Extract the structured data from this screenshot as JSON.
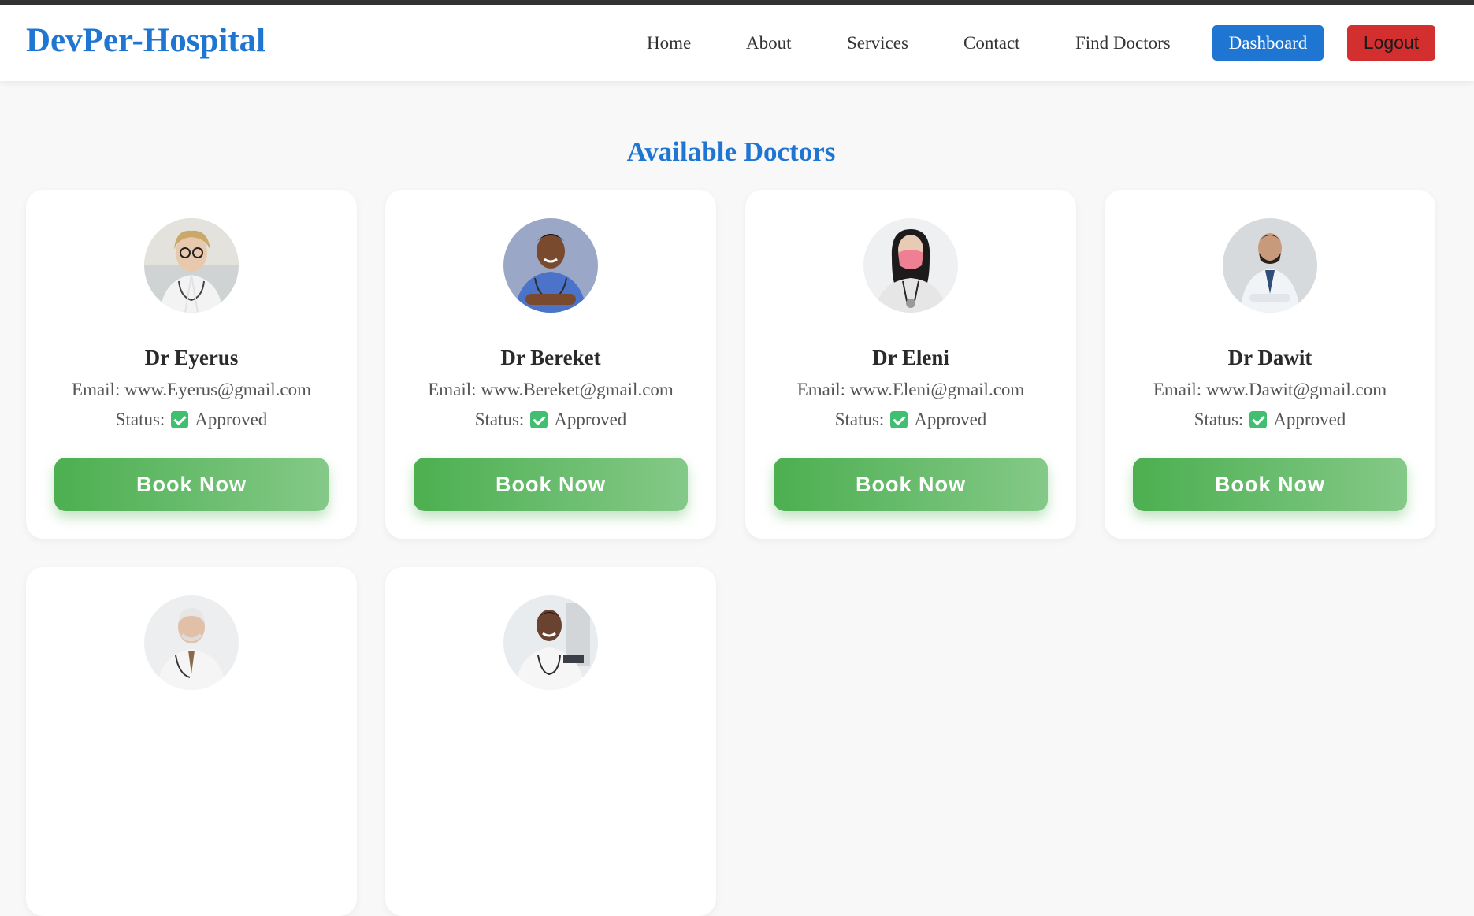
{
  "brand": "DevPer-Hospital",
  "nav": {
    "home": "Home",
    "about": "About",
    "services": "Services",
    "contact": "Contact",
    "find_doctors": "Find Doctors",
    "dashboard": "Dashboard",
    "logout": "Logout"
  },
  "colors": {
    "brand_blue": "#1f76d2",
    "logout_red": "#d32f2f",
    "book_green": "#4caf50",
    "approved_green": "#3fbf6f"
  },
  "page_title": "Available Doctors",
  "labels": {
    "email_prefix": "Email: ",
    "status_prefix": "Status:",
    "book_button": "Book Now"
  },
  "doctors": [
    {
      "name": "Dr Eyerus",
      "email": "www.Eyerus@gmail.com",
      "status": "Approved"
    },
    {
      "name": "Dr Bereket",
      "email": "www.Bereket@gmail.com",
      "status": "Approved"
    },
    {
      "name": "Dr Eleni",
      "email": "www.Eleni@gmail.com",
      "status": "Approved"
    },
    {
      "name": "Dr Dawit",
      "email": "www.Dawit@gmail.com",
      "status": "Approved"
    },
    {
      "name": "",
      "email": "",
      "status": ""
    },
    {
      "name": "",
      "email": "",
      "status": ""
    }
  ]
}
